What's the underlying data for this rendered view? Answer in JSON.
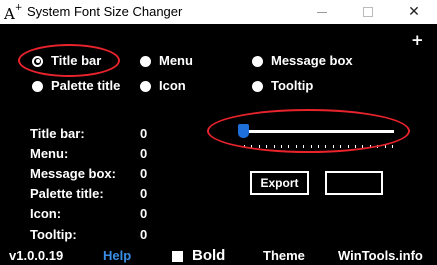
{
  "window": {
    "app_icon": "A+",
    "title": "System Font Size Changer",
    "minimize_glyph": "",
    "maximize_glyph": "",
    "close_glyph": "✕"
  },
  "plus_button": "+",
  "radios": {
    "title_bar": {
      "label": "Title bar",
      "selected": true
    },
    "menu": {
      "label": "Menu",
      "selected": false
    },
    "message_box": {
      "label": "Message box",
      "selected": false
    },
    "palette_title": {
      "label": "Palette title",
      "selected": false
    },
    "icon": {
      "label": "Icon",
      "selected": false
    },
    "tooltip": {
      "label": "Tooltip",
      "selected": false
    }
  },
  "sizes": [
    {
      "label": "Title bar:",
      "value": "0"
    },
    {
      "label": "Menu:",
      "value": "0"
    },
    {
      "label": "Message box:",
      "value": "0"
    },
    {
      "label": "Palette title:",
      "value": "0"
    },
    {
      "label": "Icon:",
      "value": "0"
    },
    {
      "label": "Tooltip:",
      "value": "0"
    }
  ],
  "slider": {
    "value": 0,
    "min": 0,
    "max": 20
  },
  "export_button": "Export",
  "footer": {
    "version": "v1.0.0.19",
    "help": "Help",
    "bold": "Bold",
    "bold_checked": false,
    "theme": "Theme",
    "site": "WinTools.info"
  },
  "colors": {
    "background": "#000000",
    "text": "#ffffff",
    "link": "#3a8ee6",
    "slider_thumb": "#1e6fd9",
    "annotation": "#e8232c"
  }
}
